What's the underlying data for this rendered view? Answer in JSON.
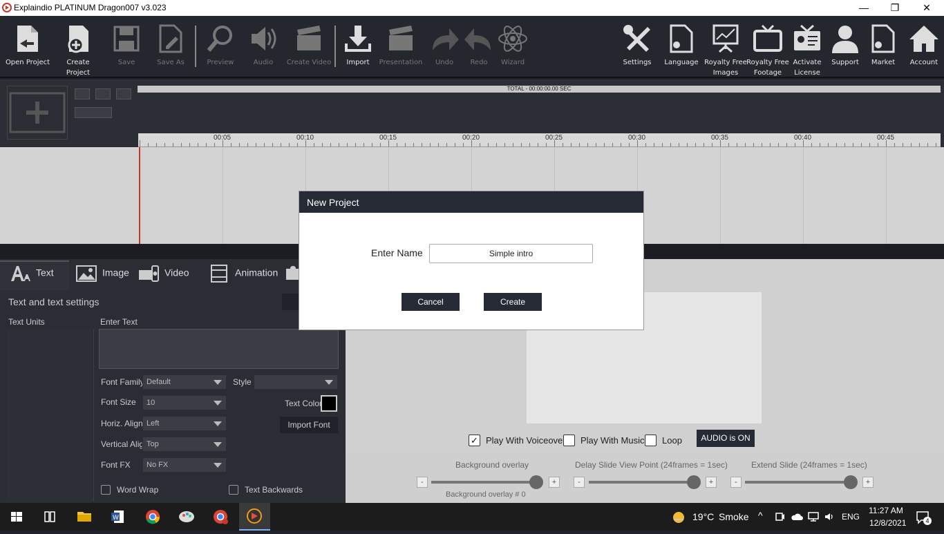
{
  "window": {
    "title": "Explaindio PLATINUM Dragon007 v3.023",
    "minimize": "—",
    "restore": "❐",
    "close": "✕"
  },
  "toolbar": {
    "open_project": "Open Project",
    "create_project": "Create Project",
    "save": "Save",
    "save_as": "Save As",
    "preview": "Preview",
    "audio": "Audio",
    "create_video": "Create Video",
    "import": "Import",
    "presentation": "Presentation",
    "undo": "Undo",
    "redo": "Redo",
    "wizard": "Wizard",
    "settings": "Settings",
    "language": "Language",
    "royalty_images_1": "Royalty Free",
    "royalty_images_2": "Images",
    "royalty_footage_1": "Royalty Free",
    "royalty_footage_2": "Footage",
    "activate_1": "Activate",
    "activate_2": "License",
    "support": "Support",
    "market": "Market",
    "account": "Account"
  },
  "timeline": {
    "total": "TOTAL - 00:00:00.00 SEC",
    "ticks": [
      "00:05",
      "00:10",
      "00:15",
      "00:20",
      "00:25",
      "00:30",
      "00:35",
      "00:40",
      "00:45"
    ]
  },
  "tabs": {
    "text": "Text",
    "image": "Image",
    "video": "Video",
    "animation": "Animation"
  },
  "text_panel": {
    "heading": "Text and text settings",
    "text_units": "Text Units",
    "enter_text": "Enter Text",
    "font_family_label": "Font Family",
    "font_family_value": "Default",
    "style_label": "Style",
    "font_size_label": "Font Size",
    "font_size_value": "10",
    "text_color_label": "Text Color",
    "horiz_align_label": "Horiz. Align",
    "horiz_align_value": "Left",
    "import_font": "Import Font",
    "vertical_align_label": "Vertical Align",
    "vertical_align_value": "Top",
    "font_fx_label": "Font FX",
    "font_fx_value": "No FX",
    "word_wrap": "Word Wrap",
    "text_backwards": "Text Backwards"
  },
  "playback": {
    "play_with_voiceover": "Play With Voiceover",
    "play_with_music": "Play With Music",
    "loop": "Loop",
    "audio_status": "AUDIO is ON",
    "background_overlay": "Background overlay",
    "delay_slide": "Delay Slide View Point (24frames = 1sec)",
    "extend_slide": "Extend Slide (24frames = 1sec)",
    "background_overlay_value": "Background overlay  # 0"
  },
  "dialog": {
    "title": "New Project",
    "name_label": "Enter Name",
    "name_value": "Simple intro",
    "cancel": "Cancel",
    "create": "Create"
  },
  "taskbar": {
    "weather_temp": "19°C",
    "weather_desc": "Smoke",
    "language": "ENG",
    "time": "11:27 AM",
    "date": "12/8/2021",
    "notifications": "4"
  },
  "colors": {
    "toolbar_bg": "#24272d",
    "dialog_header": "#252a34",
    "playhead": "#c0392b"
  }
}
